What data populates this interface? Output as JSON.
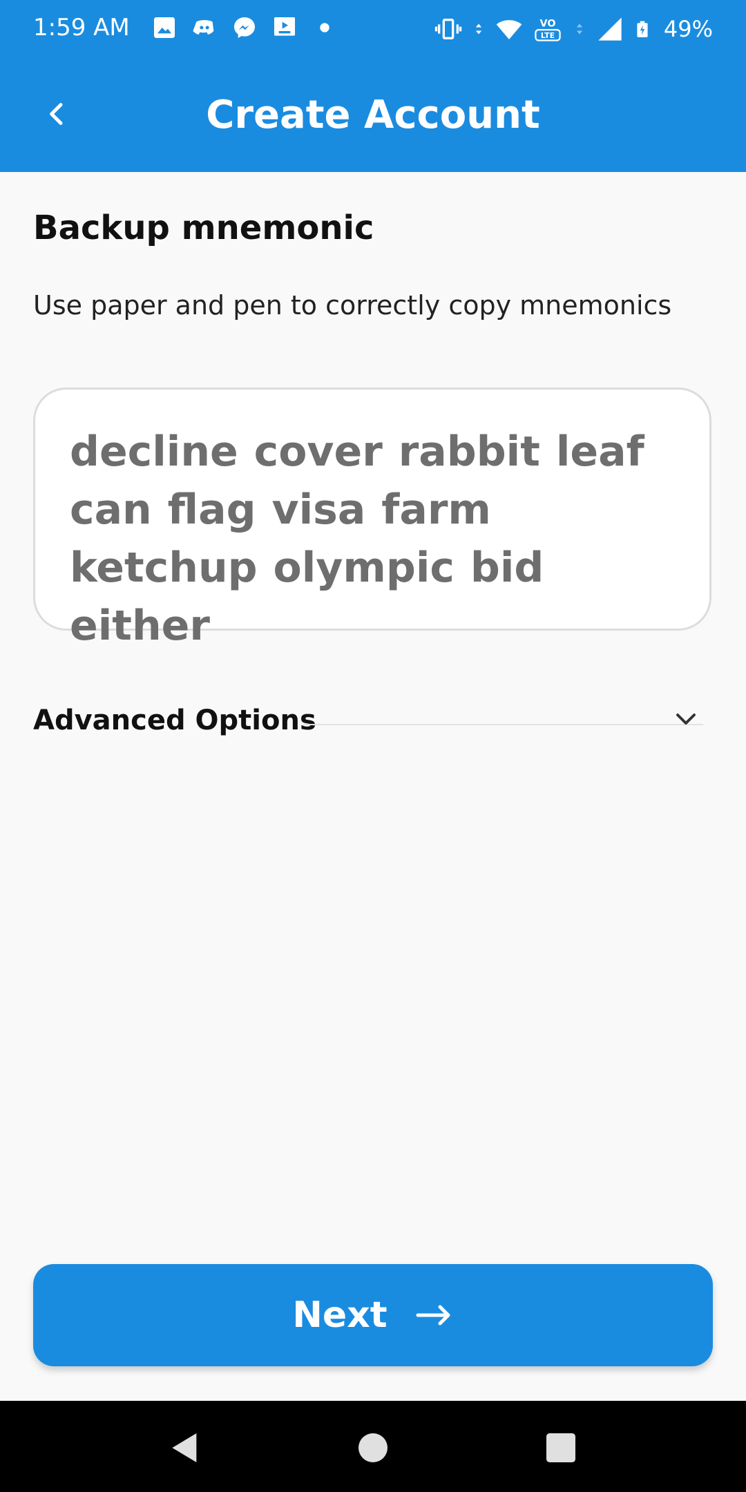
{
  "status_bar": {
    "time": "1:59 AM",
    "battery": "49%",
    "left_icons": [
      "image-icon",
      "discord-icon",
      "messenger-icon",
      "screencast-icon",
      "dot-icon"
    ],
    "right_icons": [
      "vibrate-icon",
      "data-arrows-icon",
      "wifi-icon",
      "volte-icon",
      "signal-icon",
      "battery-icon"
    ],
    "volte_label": "VO LTE"
  },
  "app_bar": {
    "title": "Create Account",
    "back_icon": "chevron-left-icon"
  },
  "content": {
    "heading": "Backup mnemonic",
    "subtext": "Use paper and pen to correctly copy mnemonics",
    "mnemonic": "decline cover rabbit leaf can flag visa farm ketchup olympic bid either",
    "advanced_options_label": "Advanced Options",
    "advanced_icon": "chevron-down-icon"
  },
  "next_button": {
    "label": "Next",
    "icon": "arrow-right-icon"
  },
  "colors": {
    "primary": "#1a8ce0",
    "background": "#f9f9f9",
    "mnemonic_text": "#6e6e6e"
  }
}
